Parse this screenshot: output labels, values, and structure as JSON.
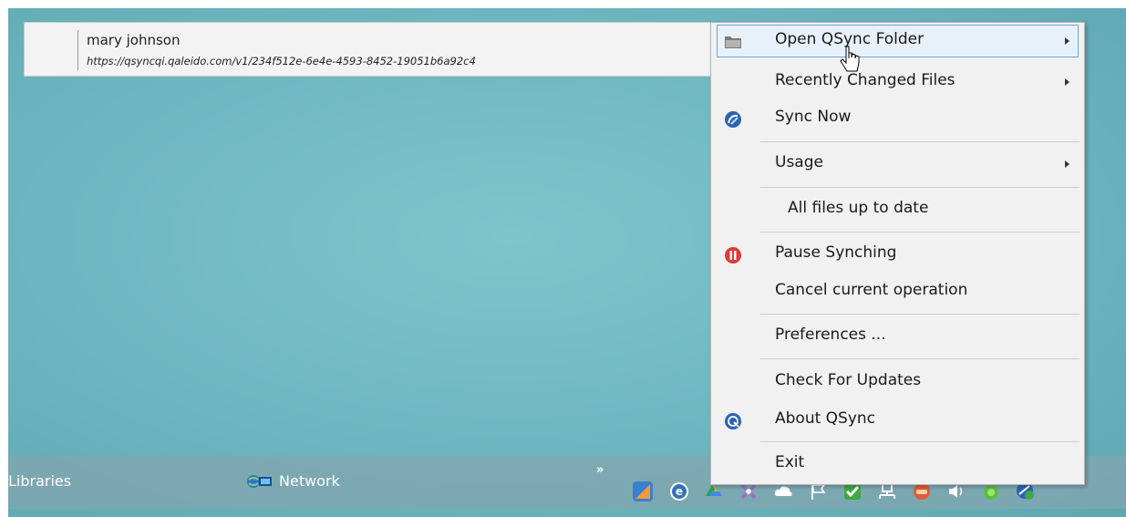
{
  "header": {
    "user": "mary johnson",
    "url": "https://qsyncqi.qaleido.com/v1/234f512e-6e4e-4593-8452-19051b6a92c4"
  },
  "taskbar": {
    "libraries_label": "Libraries",
    "network_label": "Network",
    "more_label": "»",
    "tray_icons": [
      "qsync-tray-icon",
      "browser-e-icon",
      "cloud-app-icon",
      "tool-app-icon",
      "cloud-icon",
      "flag-icon",
      "check-app-icon",
      "network-icon",
      "chat-icon",
      "volume-icon",
      "green-dot-icon",
      "qsync-status-icon"
    ]
  },
  "menu": {
    "open_folder": "Open QSync Folder",
    "recent_files": "Recently Changed Files",
    "sync_now": "Sync Now",
    "usage": "Usage",
    "status": "All files up to date",
    "pause": "Pause Synching",
    "cancel": "Cancel current operation",
    "preferences": "Preferences ...",
    "check_updates": "Check For Updates",
    "about": "About QSync",
    "exit": "Exit"
  },
  "colors": {
    "desktop": "#6eb6bf",
    "menu_bg": "#f1f1f1",
    "highlight_border": "#6aa5d9",
    "pause_red": "#e13a3a",
    "qsync_blue": "#2c64b4"
  }
}
